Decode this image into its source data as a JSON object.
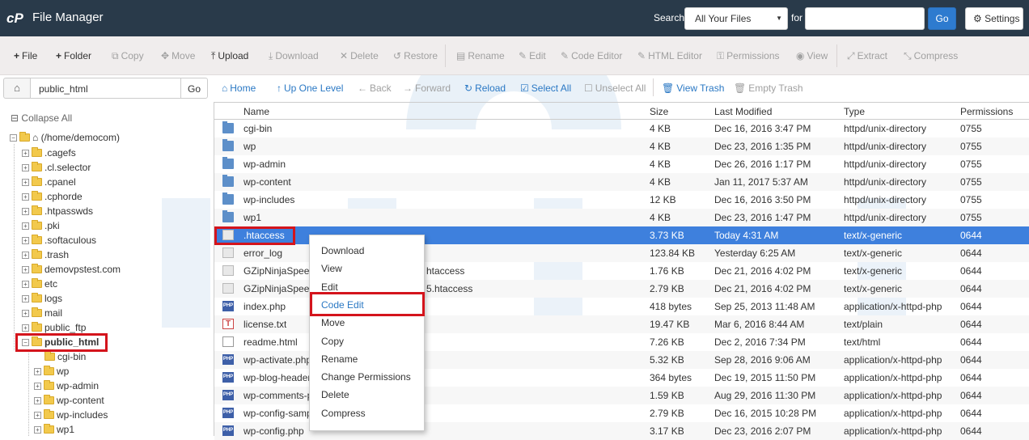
{
  "app": {
    "title": "File Manager"
  },
  "search": {
    "label": "Search",
    "scope": "All Your Files",
    "for_label": "for",
    "go": "Go",
    "settings": "Settings"
  },
  "toolbar": {
    "file": "File",
    "folder": "Folder",
    "copy": "Copy",
    "move": "Move",
    "upload": "Upload",
    "download": "Download",
    "delete": "Delete",
    "restore": "Restore",
    "rename": "Rename",
    "edit": "Edit",
    "code_editor": "Code Editor",
    "html_editor": "HTML Editor",
    "permissions": "Permissions",
    "view": "View",
    "extract": "Extract",
    "compress": "Compress"
  },
  "pathbar": {
    "value": "public_html",
    "go": "Go"
  },
  "navbar": {
    "home": "Home",
    "up": "Up One Level",
    "back": "Back",
    "forward": "Forward",
    "reload": "Reload",
    "select_all": "Select All",
    "unselect_all": "Unselect All",
    "view_trash": "View Trash",
    "empty_trash": "Empty Trash"
  },
  "tree": {
    "collapse_all": "Collapse All",
    "root": "(/home/democom)",
    "items": [
      ".cagefs",
      ".cl.selector",
      ".cpanel",
      ".cphorde",
      ".htpasswds",
      ".pki",
      ".softaculous",
      ".trash",
      "demovpstest.com",
      "etc",
      "logs",
      "mail",
      "public_ftp",
      "public_html"
    ],
    "children": [
      "cgi-bin",
      "wp",
      "wp-admin",
      "wp-content",
      "wp-includes",
      "wp1"
    ]
  },
  "table": {
    "headers": {
      "name": "Name",
      "size": "Size",
      "modified": "Last Modified",
      "type": "Type",
      "perms": "Permissions"
    },
    "rows": [
      {
        "icon": "folder",
        "name": "cgi-bin",
        "size": "4 KB",
        "modified": "Dec 16, 2016 3:47 PM",
        "type": "httpd/unix-directory",
        "perms": "0755"
      },
      {
        "icon": "folder",
        "name": "wp",
        "size": "4 KB",
        "modified": "Dec 23, 2016 1:35 PM",
        "type": "httpd/unix-directory",
        "perms": "0755"
      },
      {
        "icon": "folder",
        "name": "wp-admin",
        "size": "4 KB",
        "modified": "Dec 26, 2016 1:17 PM",
        "type": "httpd/unix-directory",
        "perms": "0755"
      },
      {
        "icon": "folder",
        "name": "wp-content",
        "size": "4 KB",
        "modified": "Jan 11, 2017 5:37 AM",
        "type": "httpd/unix-directory",
        "perms": "0755"
      },
      {
        "icon": "folder",
        "name": "wp-includes",
        "size": "12 KB",
        "modified": "Dec 16, 2016 3:50 PM",
        "type": "httpd/unix-directory",
        "perms": "0755"
      },
      {
        "icon": "folder",
        "name": "wp1",
        "size": "4 KB",
        "modified": "Dec 23, 2016 1:47 PM",
        "type": "httpd/unix-directory",
        "perms": "0755"
      },
      {
        "icon": "generic",
        "name": ".htaccess",
        "size": "3.73 KB",
        "modified": "Today 4:31 AM",
        "type": "text/x-generic",
        "perms": "0644"
      },
      {
        "icon": "generic",
        "name": "error_log",
        "size": "123.84 KB",
        "modified": "Yesterday 6:25 AM",
        "type": "text/x-generic",
        "perms": "0644"
      },
      {
        "icon": "generic",
        "name": "GZipNinjaSpeed",
        "name_tail": "htaccess",
        "size": "1.76 KB",
        "modified": "Dec 21, 2016 4:02 PM",
        "type": "text/x-generic",
        "perms": "0644"
      },
      {
        "icon": "generic",
        "name": "GZipNinjaSpeed",
        "name_tail": "5.htaccess",
        "size": "2.79 KB",
        "modified": "Dec 21, 2016 4:02 PM",
        "type": "text/x-generic",
        "perms": "0644"
      },
      {
        "icon": "php",
        "name": "index.php",
        "size": "418 bytes",
        "modified": "Sep 25, 2013 11:48 AM",
        "type": "application/x-httpd-php",
        "perms": "0644"
      },
      {
        "icon": "txt",
        "name": "license.txt",
        "size": "19.47 KB",
        "modified": "Mar 6, 2016 8:44 AM",
        "type": "text/plain",
        "perms": "0644"
      },
      {
        "icon": "html",
        "name": "readme.html",
        "size": "7.26 KB",
        "modified": "Dec 2, 2016 7:34 PM",
        "type": "text/html",
        "perms": "0644"
      },
      {
        "icon": "php",
        "name": "wp-activate.php",
        "size": "5.32 KB",
        "modified": "Sep 28, 2016 9:06 AM",
        "type": "application/x-httpd-php",
        "perms": "0644"
      },
      {
        "icon": "php",
        "name": "wp-blog-header.p",
        "size": "364 bytes",
        "modified": "Dec 19, 2015 11:50 PM",
        "type": "application/x-httpd-php",
        "perms": "0644"
      },
      {
        "icon": "php",
        "name": "wp-comments-po",
        "size": "1.59 KB",
        "modified": "Aug 29, 2016 11:30 PM",
        "type": "application/x-httpd-php",
        "perms": "0644"
      },
      {
        "icon": "php",
        "name": "wp-config-sampl",
        "size": "2.79 KB",
        "modified": "Dec 16, 2015 10:28 PM",
        "type": "application/x-httpd-php",
        "perms": "0644"
      },
      {
        "icon": "php",
        "name": "wp-config.php",
        "size": "3.17 KB",
        "modified": "Dec 23, 2016 2:07 PM",
        "type": "application/x-httpd-php",
        "perms": "0644"
      }
    ]
  },
  "context_menu": [
    "Download",
    "View",
    "Edit",
    "Code Edit",
    "Move",
    "Copy",
    "Rename",
    "Change Permissions",
    "Delete",
    "Compress"
  ],
  "icons": {
    "folder": "folder-icon",
    "generic": "text-file-icon",
    "php": "php-file-icon",
    "txt": "text-file-icon",
    "html": "html-file-icon"
  },
  "colors": {
    "topbar": "#293a4a",
    "accent": "#2a78c4",
    "selected_row": "#3e80dd",
    "highlight": "#d4141c"
  }
}
